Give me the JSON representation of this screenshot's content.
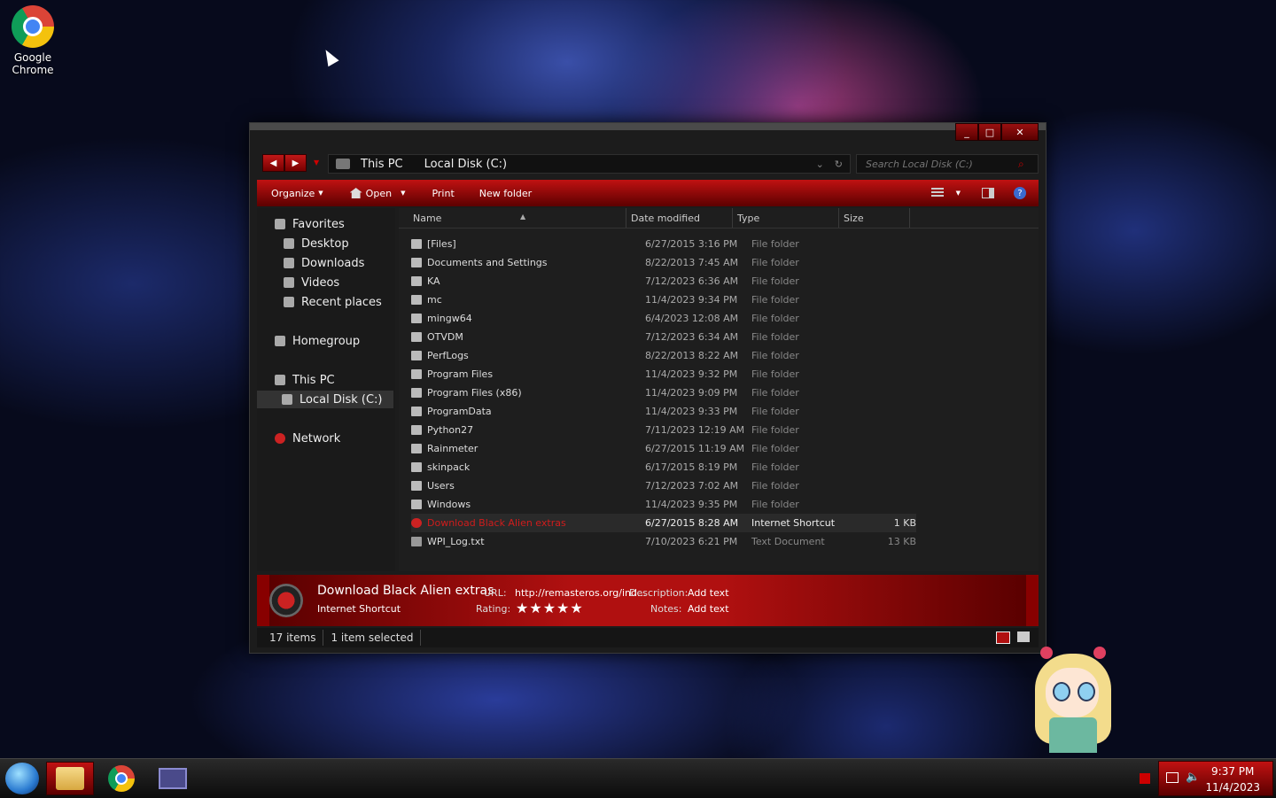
{
  "desktop": {
    "icon_label": "Google Chrome"
  },
  "window": {
    "caption": {
      "min": "_",
      "max": "□",
      "close": "✕"
    },
    "nav": {
      "back": "◀",
      "forward": "▶",
      "dropdown": "▼"
    },
    "address": {
      "crumbs": [
        "This PC",
        "Local Disk (C:)"
      ],
      "dropdown": "⌄",
      "refresh": "↻"
    },
    "search": {
      "placeholder": "Search Local Disk (C:)"
    },
    "toolbar": {
      "organize": "Organize",
      "open": "Open",
      "print": "Print",
      "new_folder": "New folder"
    },
    "navpane": {
      "favorites": "Favorites",
      "desktop": "Desktop",
      "downloads": "Downloads",
      "videos": "Videos",
      "recent": "Recent places",
      "homegroup": "Homegroup",
      "this_pc": "This PC",
      "local_disk": "Local Disk (C:)",
      "network": "Network"
    },
    "columns": {
      "name": "Name",
      "date": "Date modified",
      "type": "Type",
      "size": "Size"
    },
    "files": [
      {
        "name": "[Files]",
        "date": "6/27/2015 3:16 PM",
        "type": "File folder",
        "size": ""
      },
      {
        "name": "Documents and Settings",
        "date": "8/22/2013 7:45 AM",
        "type": "File folder",
        "size": ""
      },
      {
        "name": "KA",
        "date": "7/12/2023 6:36 AM",
        "type": "File folder",
        "size": ""
      },
      {
        "name": "mc",
        "date": "11/4/2023 9:34 PM",
        "type": "File folder",
        "size": ""
      },
      {
        "name": "mingw64",
        "date": "6/4/2023 12:08 AM",
        "type": "File folder",
        "size": ""
      },
      {
        "name": "OTVDM",
        "date": "7/12/2023 6:34 AM",
        "type": "File folder",
        "size": ""
      },
      {
        "name": "PerfLogs",
        "date": "8/22/2013 8:22 AM",
        "type": "File folder",
        "size": ""
      },
      {
        "name": "Program Files",
        "date": "11/4/2023 9:32 PM",
        "type": "File folder",
        "size": ""
      },
      {
        "name": "Program Files (x86)",
        "date": "11/4/2023 9:09 PM",
        "type": "File folder",
        "size": ""
      },
      {
        "name": "ProgramData",
        "date": "11/4/2023 9:33 PM",
        "type": "File folder",
        "size": ""
      },
      {
        "name": "Python27",
        "date": "7/11/2023 12:19 AM",
        "type": "File folder",
        "size": ""
      },
      {
        "name": "Rainmeter",
        "date": "6/27/2015 11:19 AM",
        "type": "File folder",
        "size": ""
      },
      {
        "name": "skinpack",
        "date": "6/17/2015 8:19 PM",
        "type": "File folder",
        "size": ""
      },
      {
        "name": "Users",
        "date": "7/12/2023 7:02 AM",
        "type": "File folder",
        "size": ""
      },
      {
        "name": "Windows",
        "date": "11/4/2023 9:35 PM",
        "type": "File folder",
        "size": ""
      },
      {
        "name": "Download Black Alien extras",
        "date": "6/27/2015 8:28 AM",
        "type": "Internet Shortcut",
        "size": "1 KB"
      },
      {
        "name": "WPI_Log.txt",
        "date": "7/10/2023 6:21 PM",
        "type": "Text Document",
        "size": "13 KB"
      }
    ],
    "details": {
      "title": "Download Black Alien extras",
      "type": "Internet Shortcut",
      "url_label": "URL:",
      "url_value": "http://remasteros.org/ind...",
      "desc_label": "Description:",
      "desc_value": "Add text",
      "rating_label": "Rating:",
      "rating_stars": "★★★★★",
      "notes_label": "Notes:",
      "notes_value": "Add text"
    },
    "status": {
      "items": "17 items",
      "selected": "1 item selected"
    }
  },
  "taskbar": {
    "time": "9:37 PM",
    "date": "11/4/2023"
  }
}
